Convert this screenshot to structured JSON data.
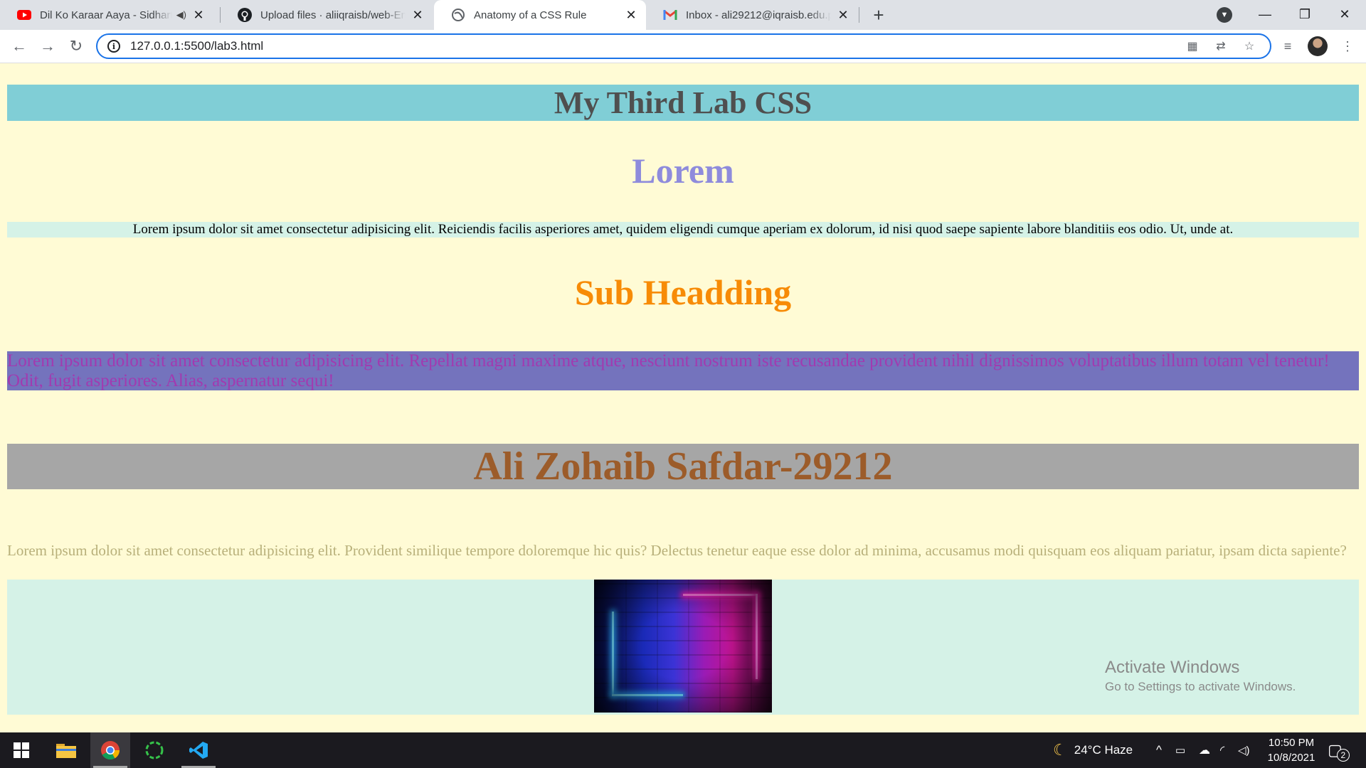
{
  "browser": {
    "tabs": [
      {
        "title": "Dil Ko Karaar Aaya - Sidharth",
        "favicon": "youtube-icon",
        "audio": true,
        "active": false
      },
      {
        "title": "Upload files · aliiqraisb/web-Engi",
        "favicon": "github-icon",
        "active": false
      },
      {
        "title": "Anatomy of a CSS Rule",
        "favicon": "globe-icon",
        "active": true
      },
      {
        "title": "Inbox - ali29212@iqraisb.edu.pk",
        "favicon": "gmail-icon",
        "active": false
      }
    ],
    "url": "127.0.0.1:5500/lab3.html"
  },
  "page": {
    "h1": "My Third Lab CSS",
    "lorem_heading": "Lorem",
    "para1": "Lorem ipsum dolor sit amet consectetur adipisicing elit. Reiciendis facilis asperiores amet, quidem eligendi cumque aperiam ex dolorum, id nisi quod saepe sapiente labore blanditiis eos odio. Ut, unde at.",
    "sub_heading": "Sub Headding",
    "para2": "Lorem ipsum dolor sit amet consectetur adipisicing elit. Repellat magni maxime atque, nesciunt nostrum iste recusandae provident nihil dignissimos voluptatibus illum totam vel tenetur! Odit, fugit asperiores. Alias, aspernatur sequi!",
    "name_heading": "Ali Zohaib Safdar-29212",
    "para3": "Lorem ipsum dolor sit amet consectetur adipisicing elit. Provident similique tempore doloremque hic quis? Delectus tenetur eaque esse dolor ad minima, accusamus modi quisquam eos aliquam pariatur, ipsam dicta sapiente?"
  },
  "watermark": {
    "line1": "Activate Windows",
    "line2": "Go to Settings to activate Windows."
  },
  "taskbar": {
    "weather": "24°C  Haze",
    "time": "10:50 PM",
    "date": "10/8/2021",
    "notifications": "2"
  },
  "colors": {
    "page_bg": "#fffbd5",
    "h1_bg": "#80ced6",
    "lorem_heading": "#8e8bdc",
    "para1_bg": "#d5f2e7",
    "sub_heading": "#f78b06",
    "para2_bg": "#7473bd",
    "para2_text": "#a23ab0",
    "name_bg": "#a6a6a6",
    "name_text": "#9c5c2a",
    "para3_text": "#b8b07a"
  }
}
